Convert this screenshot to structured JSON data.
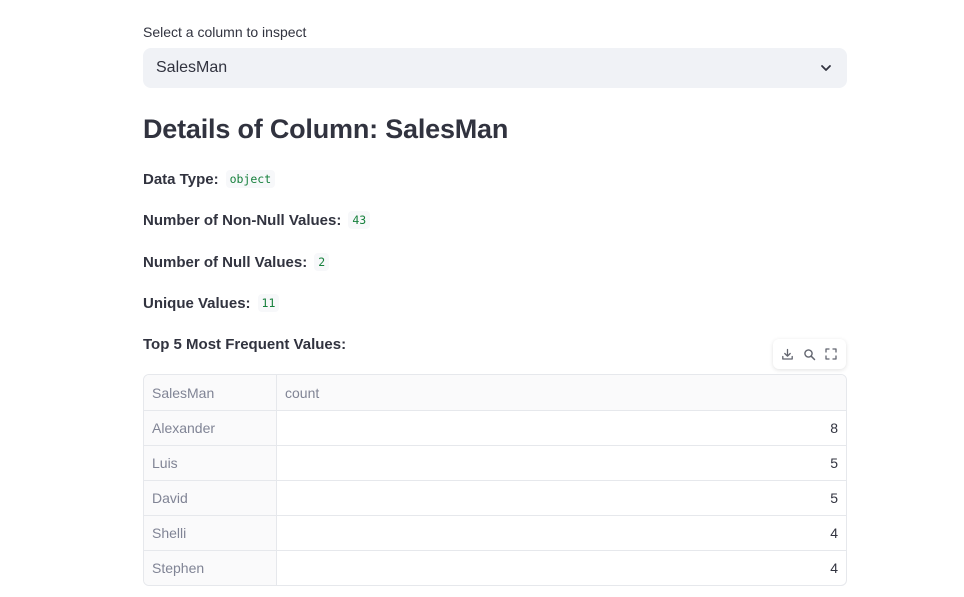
{
  "select": {
    "label": "Select a column to inspect",
    "value": "SalesMan"
  },
  "heading": "Details of Column: SalesMan",
  "stats": {
    "dtype_label": "Data Type:",
    "dtype_value": "object",
    "nonnull_label": "Number of Non-Null Values:",
    "nonnull_value": "43",
    "null_label": "Number of Null Values:",
    "null_value": "2",
    "unique_label": "Unique Values:",
    "unique_value": "11",
    "top_label": "Top 5 Most Frequent Values:"
  },
  "toolbar": {
    "icons": [
      "download-icon",
      "search-icon",
      "fullscreen-icon"
    ]
  },
  "table": {
    "columns": [
      "SalesMan",
      "count"
    ],
    "rows": [
      {
        "name": "Alexander",
        "count": "8"
      },
      {
        "name": "Luis",
        "count": "5"
      },
      {
        "name": "David",
        "count": "5"
      },
      {
        "name": "Shelli",
        "count": "4"
      },
      {
        "name": "Stephen",
        "count": "4"
      }
    ]
  },
  "colors": {
    "select_bg": "#f0f2f6",
    "code_text": "#16803c",
    "text": "#31333f",
    "muted": "#808495"
  }
}
